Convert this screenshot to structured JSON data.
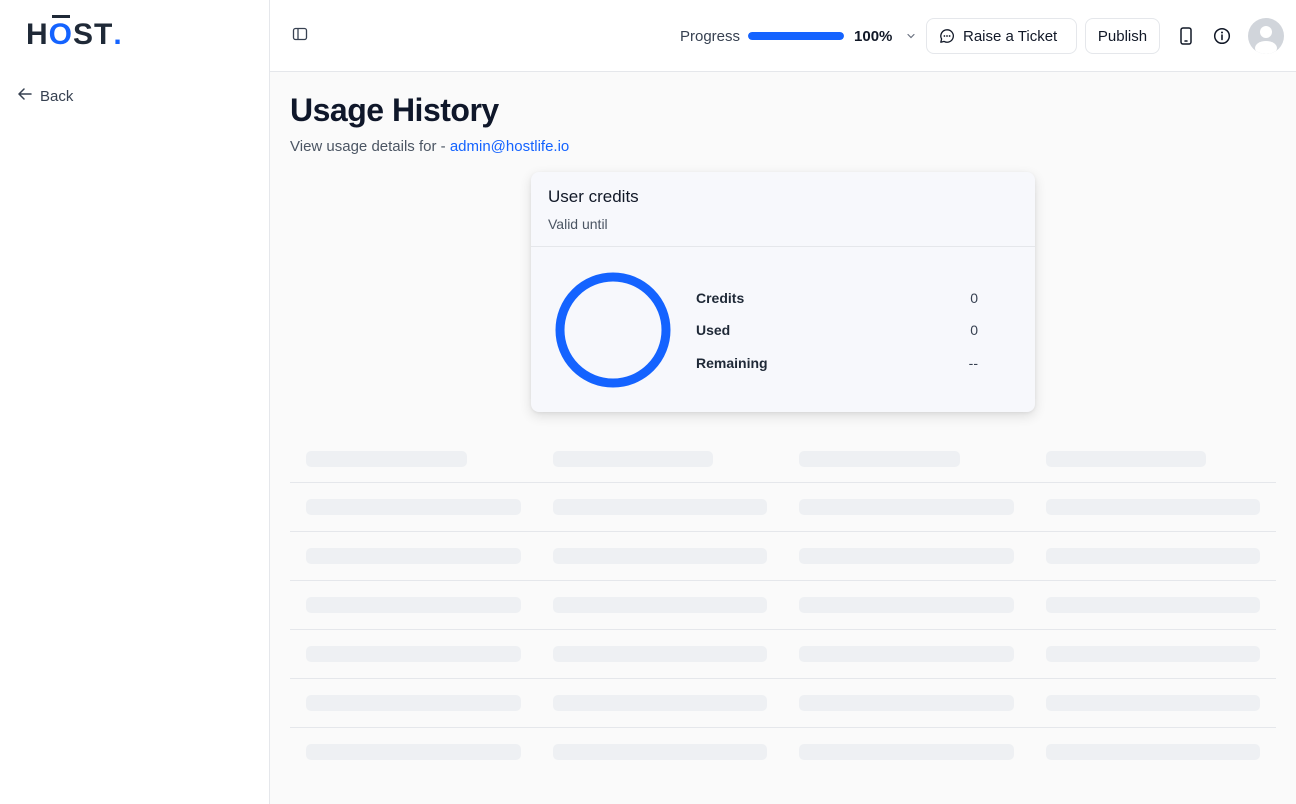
{
  "brand": {
    "logo_h": "H",
    "logo_o": "O",
    "logo_rest": "ST",
    "logo_dot": "."
  },
  "sidebar": {
    "back_label": "Back"
  },
  "topbar": {
    "progress_label": "Progress",
    "progress_value": 100,
    "progress_text": "100%",
    "raise_ticket_label": "Raise a Ticket",
    "publish_label": "Publish",
    "icons": [
      "sidebar-toggle-icon",
      "chevron-down-icon",
      "chat-bubble-icon",
      "mobile-device-icon",
      "info-icon",
      "user-avatar-icon"
    ]
  },
  "page": {
    "title": "Usage History",
    "subtitle_prefix": "View usage details for - ",
    "email": "admin@hostlife.io"
  },
  "credits_card": {
    "title": "User credits",
    "valid_until_label": "Valid until",
    "stats": [
      {
        "label": "Credits",
        "value": "0"
      },
      {
        "label": "Used",
        "value": "0"
      },
      {
        "label": "Remaining",
        "value": "--"
      }
    ]
  },
  "colors": {
    "accent": "#1463ff",
    "skeleton": "#eef0f3",
    "border": "#e5e7eb"
  }
}
